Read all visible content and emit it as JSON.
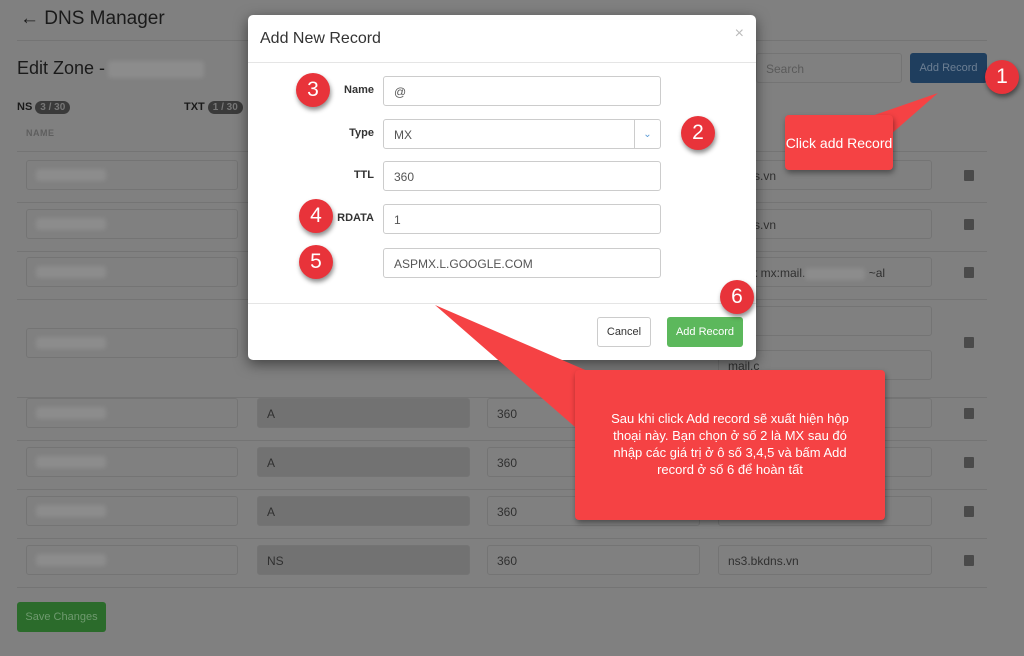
{
  "header": {
    "title": "DNS Manager",
    "back_icon": "arrow-left-icon"
  },
  "zone": {
    "label": "Edit Zone -"
  },
  "counts": [
    {
      "type": "NS",
      "badge": "3 / 30"
    },
    {
      "type": "TXT",
      "badge": "1 / 30"
    }
  ],
  "columns": {
    "name": "NAME"
  },
  "toolbar": {
    "search_placeholder": "Search",
    "add_record": "Add Record"
  },
  "rows": [
    {
      "type": "",
      "ttl": "",
      "rdata": "bkdns.vn"
    },
    {
      "type": "",
      "ttl": "",
      "rdata": "bkdns.vn"
    },
    {
      "type": "",
      "ttl": "",
      "rdata": "f1 mx mx:mail.",
      "rdata_tail": "~al"
    },
    {
      "type": "",
      "ttl": "",
      "rdata": "",
      "rdata2": "mail.c"
    },
    {
      "type": "A",
      "ttl": "360",
      "rdata": ""
    },
    {
      "type": "A",
      "ttl": "360",
      "rdata": ""
    },
    {
      "type": "A",
      "ttl": "360",
      "rdata": ""
    },
    {
      "type": "NS",
      "ttl": "360",
      "rdata": "ns3.bkdns.vn"
    }
  ],
  "save_label": "Save Changes",
  "modal": {
    "title": "Add New Record",
    "close": "×",
    "fields": {
      "name_label": "Name",
      "name_value": "@",
      "type_label": "Type",
      "type_value": "MX",
      "ttl_label": "TTL",
      "ttl_value": "360",
      "rdata_label": "RDATA",
      "rdata_value": "1",
      "extra_value": "ASPMX.L.GOOGLE.COM"
    },
    "cancel": "Cancel",
    "add": "Add Record"
  },
  "annotations": {
    "steps": [
      "1",
      "2",
      "3",
      "4",
      "5",
      "6"
    ],
    "callout_small": "Click add Record",
    "callout_big": "Sau khi click Add record sẽ xuất hiện hộp thoại này. Bạn chọn ở số 2 là MX sau đó nhập các giá trị ở ô số 3,4,5 và bấm Add record ở số 6 để hoàn tất"
  },
  "colors": {
    "accent_blue": "#1f4e79",
    "green": "#5cb85c",
    "annotation_red": "#f54244"
  }
}
